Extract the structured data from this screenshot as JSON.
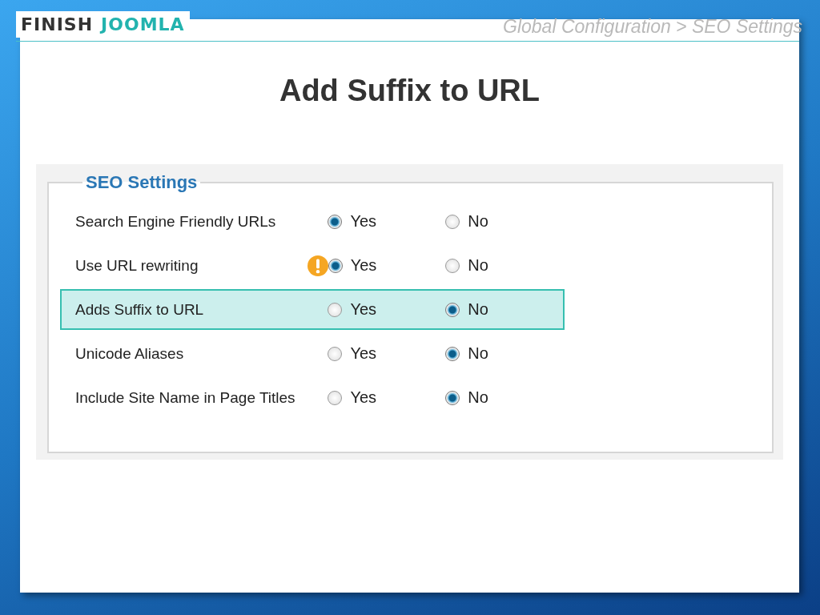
{
  "logo": {
    "word_1": "FINISH",
    "word_2": "JOOMLA"
  },
  "breadcrumb": "Global Configuration > SEO Settings",
  "title": "Add Suffix to URL",
  "panel": {
    "legend": "SEO Settings",
    "rows": [
      {
        "label": "Search Engine Friendly URLs",
        "warning": false,
        "highlighted": false,
        "options": [
          {
            "label": "Yes",
            "selected": true
          },
          {
            "label": "No",
            "selected": false
          }
        ]
      },
      {
        "label": "Use URL rewriting",
        "warning": true,
        "highlighted": false,
        "options": [
          {
            "label": "Yes",
            "selected": true
          },
          {
            "label": "No",
            "selected": false
          }
        ]
      },
      {
        "label": "Adds Suffix to URL",
        "warning": false,
        "highlighted": true,
        "options": [
          {
            "label": "Yes",
            "selected": false
          },
          {
            "label": "No",
            "selected": true
          }
        ]
      },
      {
        "label": "Unicode Aliases",
        "warning": false,
        "highlighted": false,
        "options": [
          {
            "label": "Yes",
            "selected": false
          },
          {
            "label": "No",
            "selected": true
          }
        ]
      },
      {
        "label": "Include Site Name in Page Titles",
        "warning": false,
        "highlighted": false,
        "options": [
          {
            "label": "Yes",
            "selected": false
          },
          {
            "label": "No",
            "selected": true
          }
        ]
      }
    ]
  }
}
